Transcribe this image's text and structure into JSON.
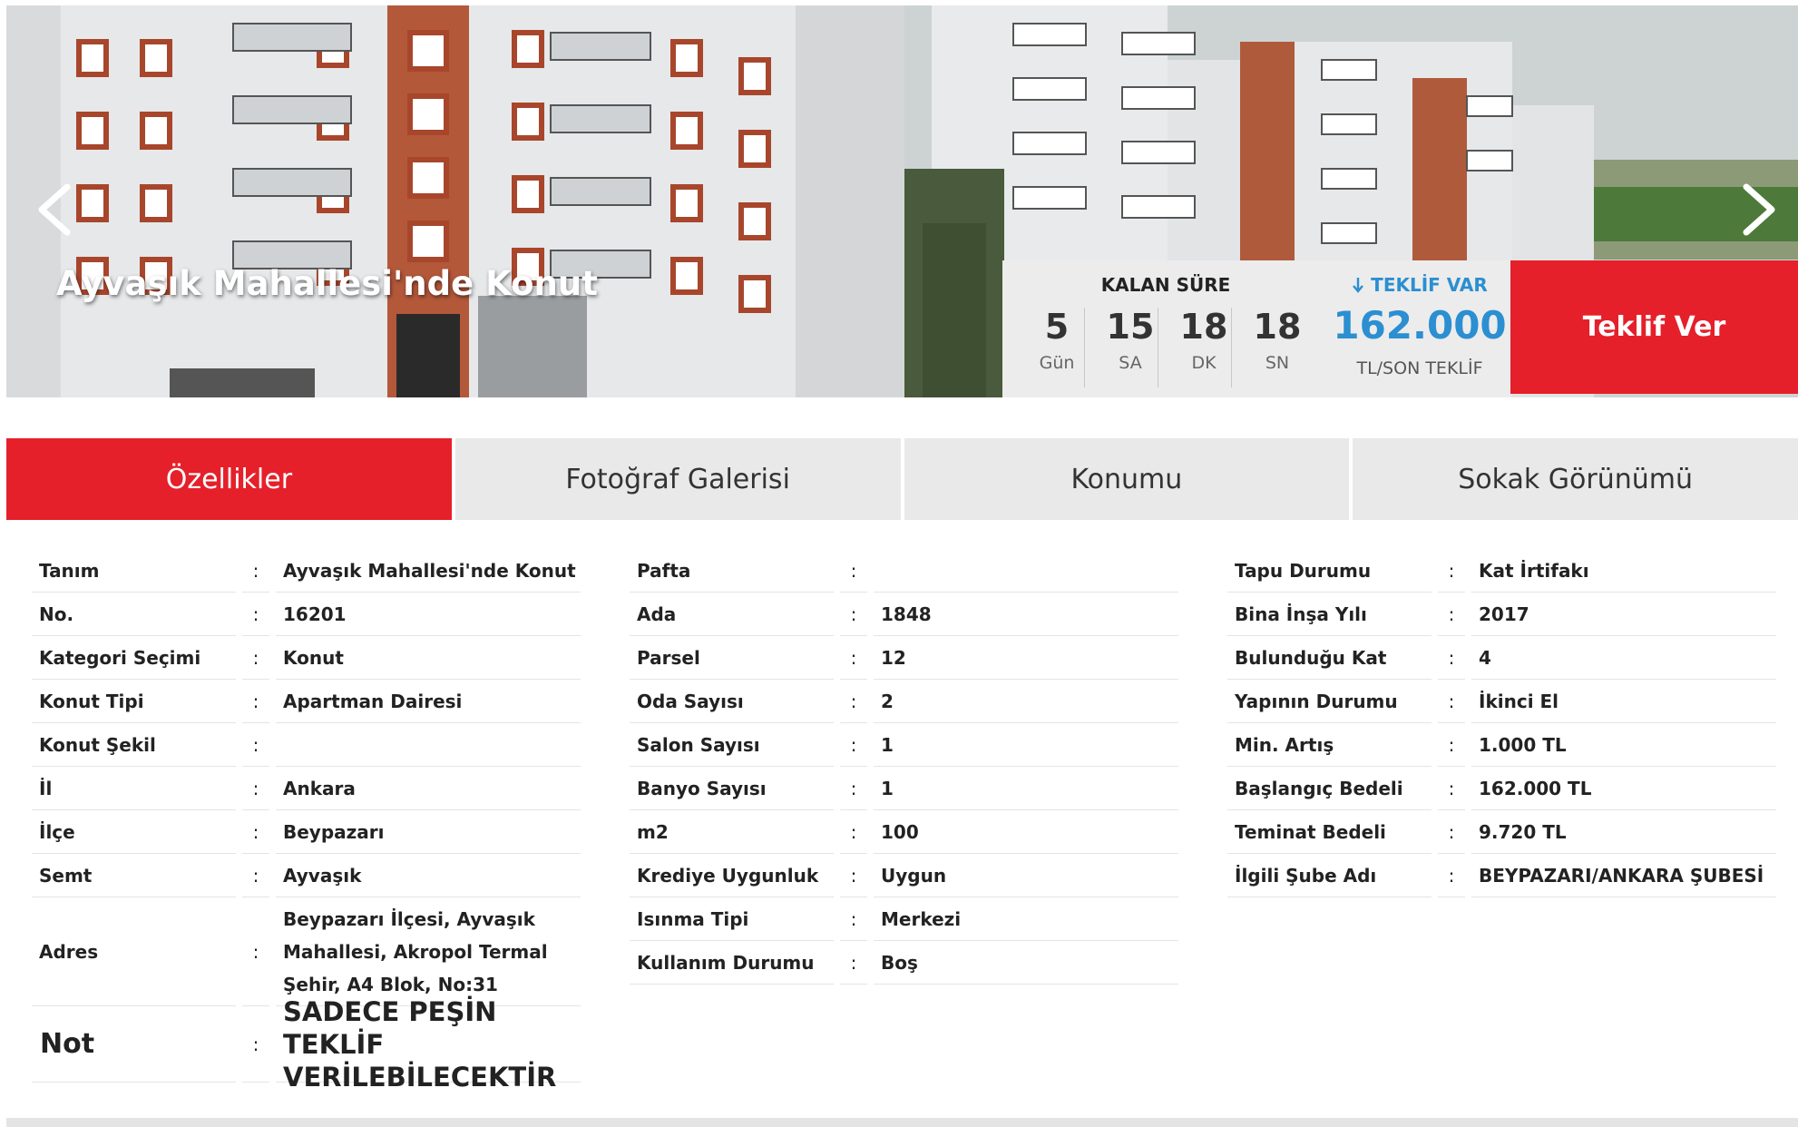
{
  "hero": {
    "title": "Ayvaşık Mahallesi'nde Konut",
    "prev_icon": "chevron-left-icon",
    "next_icon": "chevron-right-icon"
  },
  "auction": {
    "remaining_label": "KALAN SÜRE",
    "countdown": [
      {
        "value": "5",
        "unit": "Gün"
      },
      {
        "value": "15",
        "unit": "SA"
      },
      {
        "value": "18",
        "unit": "DK"
      },
      {
        "value": "18",
        "unit": "SN"
      }
    ],
    "bid_flag_label": "TEKLİF VAR",
    "bid_amount": "162.000",
    "bid_sub": "TL/SON TEKLİF",
    "bid_button": "Teklif Ver"
  },
  "tabs": [
    "Özellikler",
    "Fotoğraf Galerisi",
    "Konumu",
    "Sokak Görünümü"
  ],
  "details": {
    "col1": [
      {
        "k": "Tanım",
        "v": "Ayvaşık Mahallesi'nde Konut"
      },
      {
        "k": "No.",
        "v": "16201"
      },
      {
        "k": "Kategori Seçimi",
        "v": "Konut"
      },
      {
        "k": "Konut Tipi",
        "v": "Apartman Dairesi"
      },
      {
        "k": "Konut Şekil",
        "v": ""
      },
      {
        "k": "İl",
        "v": "Ankara"
      },
      {
        "k": "İlçe",
        "v": "Beypazarı"
      },
      {
        "k": "Semt",
        "v": "Ayvaşık"
      },
      {
        "k": "Adres",
        "v": "Beypazarı İlçesi, Ayvaşık Mahallesi, Akropol Termal Şehir, A4 Blok, No:31"
      },
      {
        "k": "Not",
        "v": "SADECE PEŞİN TEKLİF VERİLEBİLECEKTİR"
      }
    ],
    "col2": [
      {
        "k": "Pafta",
        "v": ""
      },
      {
        "k": "Ada",
        "v": "1848"
      },
      {
        "k": "Parsel",
        "v": "12"
      },
      {
        "k": "Oda Sayısı",
        "v": "2"
      },
      {
        "k": "Salon Sayısı",
        "v": "1"
      },
      {
        "k": "Banyo Sayısı",
        "v": "1"
      },
      {
        "k": "m2",
        "v": "100"
      },
      {
        "k": "Krediye Uygunluk",
        "v": "Uygun"
      },
      {
        "k": "Isınma Tipi",
        "v": "Merkezi"
      },
      {
        "k": "Kullanım Durumu",
        "v": "Boş"
      }
    ],
    "col3": [
      {
        "k": "Tapu Durumu",
        "v": "Kat İrtifakı"
      },
      {
        "k": "Bina İnşa Yılı",
        "v": "2017"
      },
      {
        "k": "Bulunduğu Kat",
        "v": "4"
      },
      {
        "k": "Yapının Durumu",
        "v": "İkinci El"
      },
      {
        "k": "Min. Artış",
        "v": "1.000 TL"
      },
      {
        "k": "Başlangıç Bedeli",
        "v": "162.000 TL"
      },
      {
        "k": "Teminat Bedeli",
        "v": "9.720 TL"
      },
      {
        "k": "İlgili Şube Adı",
        "v": "BEYPAZARI/ANKARA ŞUBESİ"
      }
    ]
  },
  "colors": {
    "brand_red": "#e5202a",
    "bid_blue": "#2b8fd1",
    "tab_gray": "#e9e9e9"
  }
}
